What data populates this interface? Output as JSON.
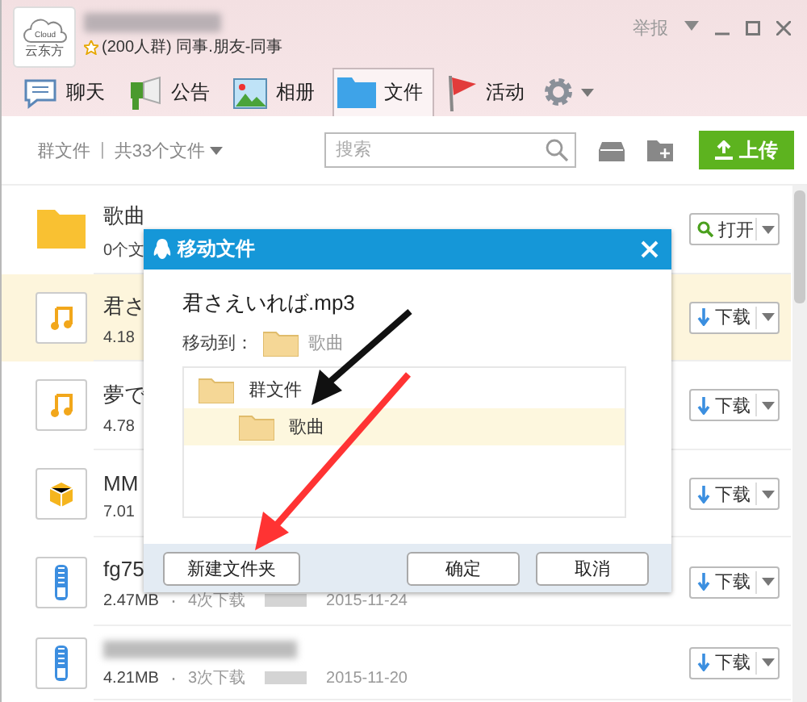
{
  "header": {
    "logo_text": "云东方",
    "logo_cloud_text": "Cloud",
    "group_info": "(200人群) 同事.朋友-同事",
    "report": "举报"
  },
  "tabs": [
    {
      "label": "聊天",
      "kind": "chat",
      "selected": false
    },
    {
      "label": "公告",
      "kind": "notice",
      "selected": false
    },
    {
      "label": "相册",
      "kind": "album",
      "selected": false
    },
    {
      "label": "文件",
      "kind": "files",
      "selected": true
    },
    {
      "label": "活动",
      "kind": "event",
      "selected": false
    }
  ],
  "toolbar": {
    "breadcrumb": "群文件",
    "separator": "|",
    "file_count": "共33个文件",
    "search": {
      "placeholder": "搜索"
    },
    "upload": "上传"
  },
  "files": [
    {
      "kind": "folder",
      "name": "歌曲",
      "size": "0个文",
      "action": {
        "label": "打开",
        "kind": "open"
      },
      "selected": false
    },
    {
      "kind": "music",
      "name": "君さ",
      "size": "4.18",
      "action": {
        "label": "下载",
        "kind": "download"
      },
      "selected": true
    },
    {
      "kind": "music",
      "name": "夢で",
      "size": "4.78",
      "action": {
        "label": "下载",
        "kind": "download"
      },
      "selected": false
    },
    {
      "kind": "package",
      "name": "MM",
      "size": "7.01",
      "action": {
        "label": "下载",
        "kind": "download"
      },
      "selected": false
    },
    {
      "kind": "zip",
      "name": "fg75",
      "size": "2.47MB",
      "separator": "·",
      "downloads": "4次下载",
      "date": "2015-11-24",
      "action": {
        "label": "下载",
        "kind": "download"
      },
      "selected": false
    },
    {
      "kind": "zip",
      "size": "4.21MB",
      "separator": "·",
      "downloads": "3次下载",
      "date": "2015-11-20",
      "action": {
        "label": "下载",
        "kind": "download"
      },
      "selected": false
    }
  ],
  "dialog": {
    "title": "移动文件",
    "file_name": "君さえいれば.mp3",
    "move_to_label": "移动到：",
    "destination": "歌曲",
    "tree": [
      {
        "label": "群文件",
        "selected": false,
        "children": [
          {
            "label": "歌曲",
            "selected": true
          }
        ]
      }
    ],
    "buttons": [
      {
        "label": "新建文件夹",
        "kind": "new"
      },
      {
        "label": "确定",
        "kind": "ok"
      },
      {
        "label": "取消",
        "kind": "cancel"
      }
    ]
  }
}
